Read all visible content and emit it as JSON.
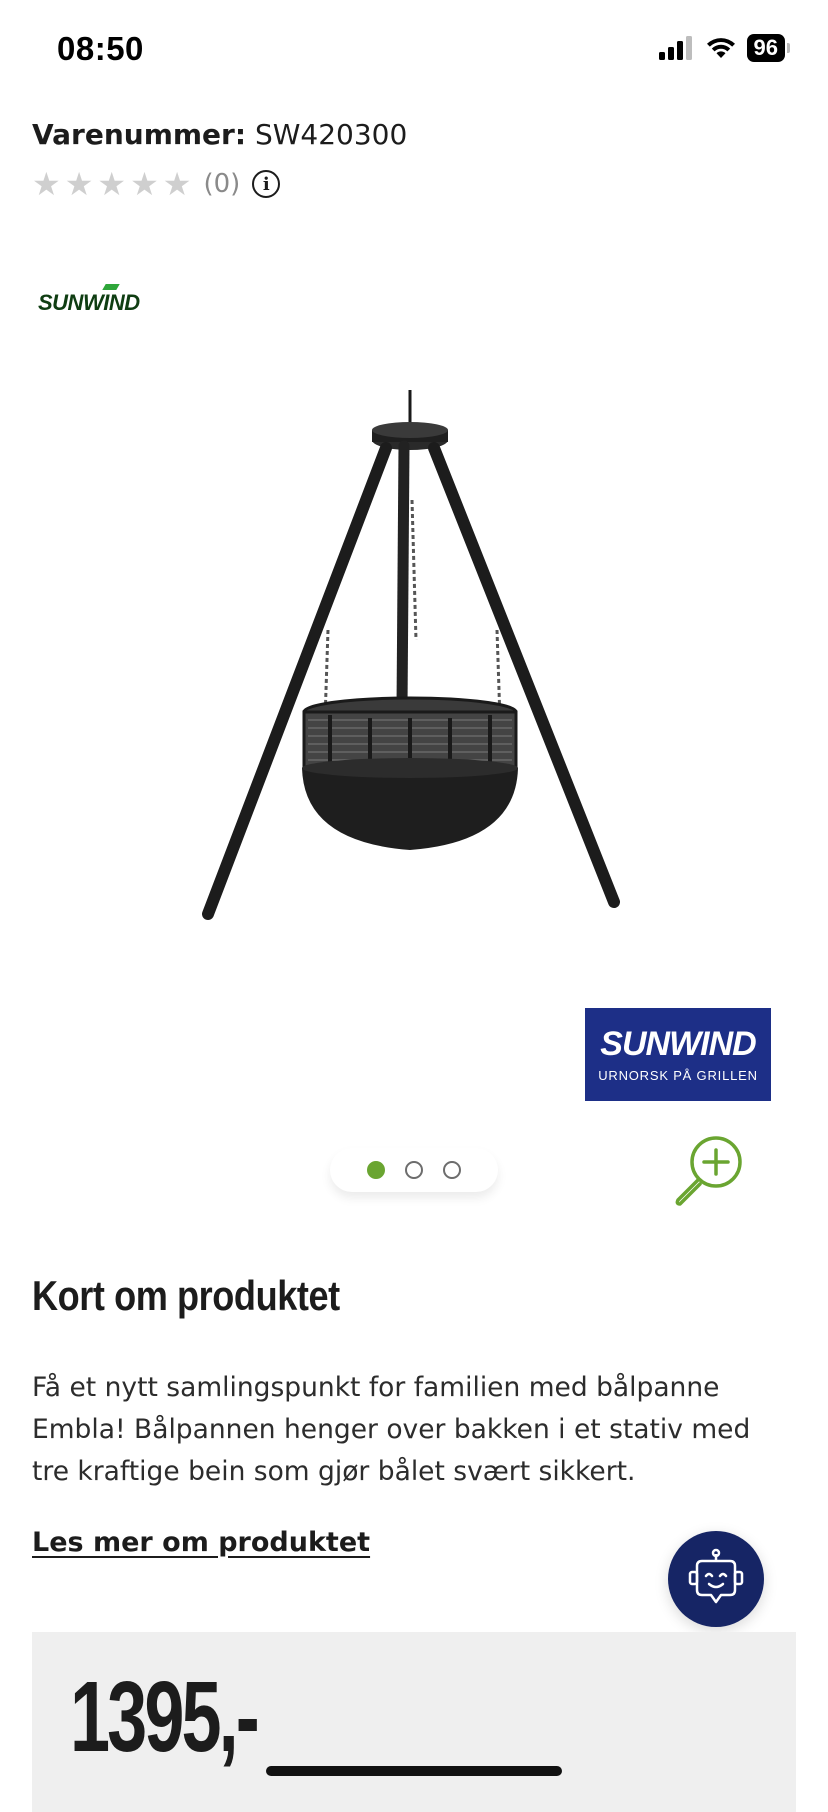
{
  "status_bar": {
    "time": "08:50",
    "battery": "96"
  },
  "product": {
    "sku_label": "Varenummer:",
    "sku_value": "SW420300",
    "rating_count": "(0)",
    "rating_value": 0,
    "rating_max": 5,
    "brand": "SUNWIND",
    "brand_slogan": "URNORSK PÅ GRILLEN",
    "image_count": 3,
    "active_image": 1
  },
  "short_description": {
    "title": "Kort om produktet",
    "text": "Få et nytt samlingspunkt for familien med bålpanne Embla! Bålpannen henger over bakken i et stativ med tre kraftige bein som gjør bålet svært sikkert.",
    "read_more": "Les mer om produktet"
  },
  "price": {
    "value": "1395,-"
  },
  "colors": {
    "accent_green": "#6aa531",
    "brand_blue": "#1d2f87",
    "chat_navy": "#162565"
  },
  "icons": {
    "signal": "signal-icon",
    "wifi": "wifi-icon",
    "info": "info-icon",
    "zoom": "zoom-in-icon",
    "chat": "chatbot-icon"
  }
}
